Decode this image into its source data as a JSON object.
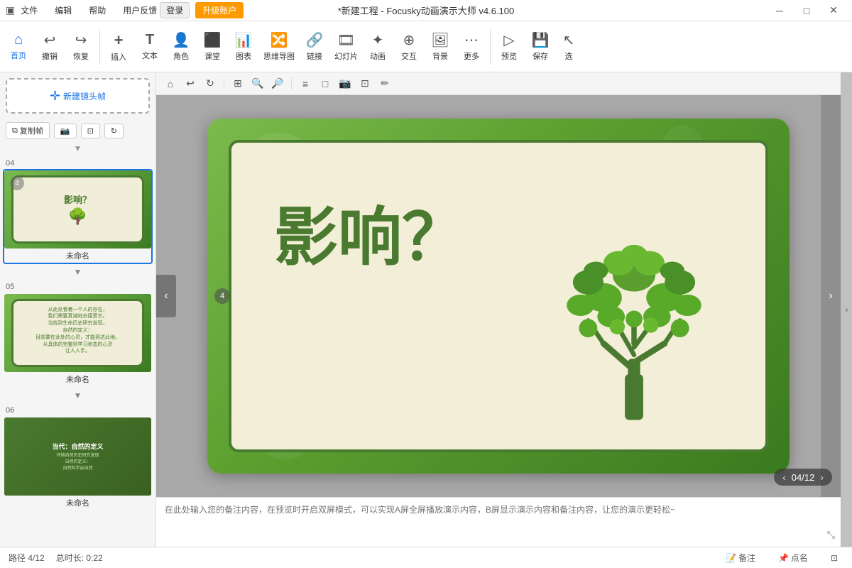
{
  "titleBar": {
    "appIcon": "▣",
    "menus": [
      "文件",
      "编辑",
      "帮助",
      "用户反馈"
    ],
    "title": "*新建工程 - Focusky动画演示大师  v4.6.100",
    "loginLabel": "登录",
    "upgradeLabel": "升级账户",
    "minimizeIcon": "─",
    "maximizeIcon": "□",
    "closeIcon": "✕"
  },
  "toolbar": {
    "items": [
      {
        "id": "home",
        "icon": "⌂",
        "label": "首页",
        "active": true
      },
      {
        "id": "undo",
        "icon": "↩",
        "label": "撤销",
        "active": false
      },
      {
        "id": "redo",
        "icon": "↪",
        "label": "恢复",
        "active": false
      },
      {
        "id": "insert",
        "icon": "+",
        "label": "插入",
        "active": false
      },
      {
        "id": "text",
        "icon": "T",
        "label": "文本",
        "active": false
      },
      {
        "id": "role",
        "icon": "👤",
        "label": "角色",
        "active": false
      },
      {
        "id": "class",
        "icon": "◫",
        "label": "课堂",
        "active": false
      },
      {
        "id": "chart",
        "icon": "📊",
        "label": "图表",
        "active": false
      },
      {
        "id": "mindmap",
        "icon": "⑆",
        "label": "思维导图",
        "active": false
      },
      {
        "id": "link",
        "icon": "🔗",
        "label": "链接",
        "active": false
      },
      {
        "id": "slideshow",
        "icon": "⬡",
        "label": "幻灯片",
        "active": false
      },
      {
        "id": "animate",
        "icon": "✦",
        "label": "动画",
        "active": false
      },
      {
        "id": "interact",
        "icon": "⊕",
        "label": "交互",
        "active": false
      },
      {
        "id": "bg",
        "icon": "🖼",
        "label": "背景",
        "active": false
      },
      {
        "id": "more",
        "icon": "⋯",
        "label": "更多",
        "active": false
      },
      {
        "id": "preview",
        "icon": "▷",
        "label": "预览",
        "active": false
      },
      {
        "id": "save",
        "icon": "💾",
        "label": "保存",
        "active": false
      },
      {
        "id": "select",
        "icon": "↖",
        "label": "选",
        "active": false
      }
    ]
  },
  "canvasTools": {
    "tools": [
      "⌂",
      "↩",
      "↻",
      "⊞",
      "🔍+",
      "🔍-",
      "|",
      "≡",
      "□⊕",
      "📷",
      "⊡",
      "✏"
    ]
  },
  "slides": [
    {
      "number": "04",
      "active": true,
      "badge": "4",
      "title": "影响？",
      "hasTree": true,
      "name": "未命名",
      "type": "title"
    },
    {
      "number": "05",
      "active": false,
      "badge": null,
      "title": "",
      "hasTree": false,
      "name": "未命名",
      "type": "text",
      "lines": [
        "从此处看着一个人的存在，",
        "我们需要真诚地去接受它。",
        "当找到生命历史研究发现，",
        "自然的定义：",
        "目前要在此处的心灵，才能到达此地。",
        "从具体的完整到学习状态的心灵",
        "让人入手。"
      ]
    },
    {
      "number": "06",
      "active": false,
      "badge": null,
      "title": "当代：自然的定义",
      "hasTree": false,
      "name": "未命名",
      "type": "dark",
      "lines": [
        "环境自然历史研究发现",
        "自然的定义：",
        "自然科学启自然"
      ]
    }
  ],
  "mainSlide": {
    "titleText": "影响？",
    "pageCounter": "04/12"
  },
  "newFrameBtn": "新建镜头帧",
  "copyFrameBtn": "复制帧",
  "frameActions": [
    "复制帧"
  ],
  "notesPlaceholder": "在此处输入您的备注内容，在预览时开启双屏模式，可以实现A屏全屏播放演示内容，B屏显示演示内容和备注内容，让您的演示更轻松~",
  "statusBar": {
    "path": "路径 4/12",
    "duration": "总时长: 0:22",
    "noteBtn": "备注",
    "pointBtn": "点名",
    "fullscreenIcon": "⊡"
  }
}
